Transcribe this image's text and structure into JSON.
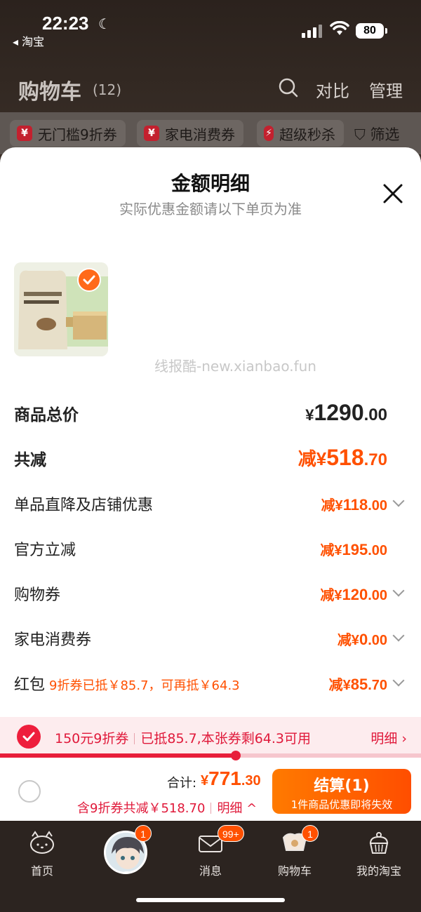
{
  "status_bar": {
    "time": "22:23",
    "back_app": "◂ 淘宝",
    "battery": "80"
  },
  "header": {
    "title": "购物车",
    "count": "(12)",
    "compare_label": "对比",
    "manage_label": "管理"
  },
  "chips": [
    {
      "icon": "¥",
      "label": "无门槛9折券"
    },
    {
      "icon": "¥",
      "label": "家电消费券"
    },
    {
      "icon": "⚡",
      "label": "超级秒杀"
    }
  ],
  "filter_label": "筛选",
  "sheet": {
    "title": "金额明细",
    "subtitle": "实际优惠金额请以下单页为准",
    "watermark": "线报酷-new.xianbao.fun",
    "total_price": {
      "label": "商品总价",
      "symbol": "¥",
      "int": "1290",
      "dec": ".00"
    },
    "total_reduce": {
      "label": "共减",
      "prefix": "减¥",
      "int": "518",
      "dec": ".70"
    },
    "items": [
      {
        "label": "单品直降及店铺优惠",
        "prefix": "减¥",
        "int": "118",
        "dec": ".00",
        "has_chevron": true,
        "note": ""
      },
      {
        "label": "官方立减",
        "prefix": "减¥",
        "int": "195",
        "dec": ".00",
        "has_chevron": false,
        "note": ""
      },
      {
        "label": "购物券",
        "prefix": "减¥",
        "int": "120",
        "dec": ".00",
        "has_chevron": true,
        "note": ""
      },
      {
        "label": "家电消费券",
        "prefix": "减¥",
        "int": "0",
        "dec": ".00",
        "has_chevron": true,
        "note": ""
      },
      {
        "label": "红包",
        "prefix": "减¥",
        "int": "85",
        "dec": ".70",
        "has_chevron": true,
        "note": "9折券已抵￥85.7，可再抵￥64.3"
      }
    ]
  },
  "coupon_bar": {
    "name": "150元9折券",
    "status": "已抵85.7,本张券剩64.3可用",
    "detail_label": "明细 ›",
    "progress": 0.56
  },
  "footer": {
    "total_label": "合计:",
    "total_symbol": "¥",
    "total_int": "771",
    "total_dec": ".30",
    "reduce_text": "含9折券共减￥518.70",
    "detail_label": "明细 ^",
    "checkout_label": "结算(1)",
    "checkout_sub": "1件商品优惠即将失效"
  },
  "tabbar": [
    {
      "label": "首页",
      "badge": ""
    },
    {
      "label": "",
      "badge": "1"
    },
    {
      "label": "消息",
      "badge": "99+"
    },
    {
      "label": "购物车",
      "badge": "1"
    },
    {
      "label": "我的淘宝",
      "badge": ""
    }
  ],
  "colors": {
    "accent_orange": "#ff5000",
    "accent_red": "#e0193a"
  }
}
